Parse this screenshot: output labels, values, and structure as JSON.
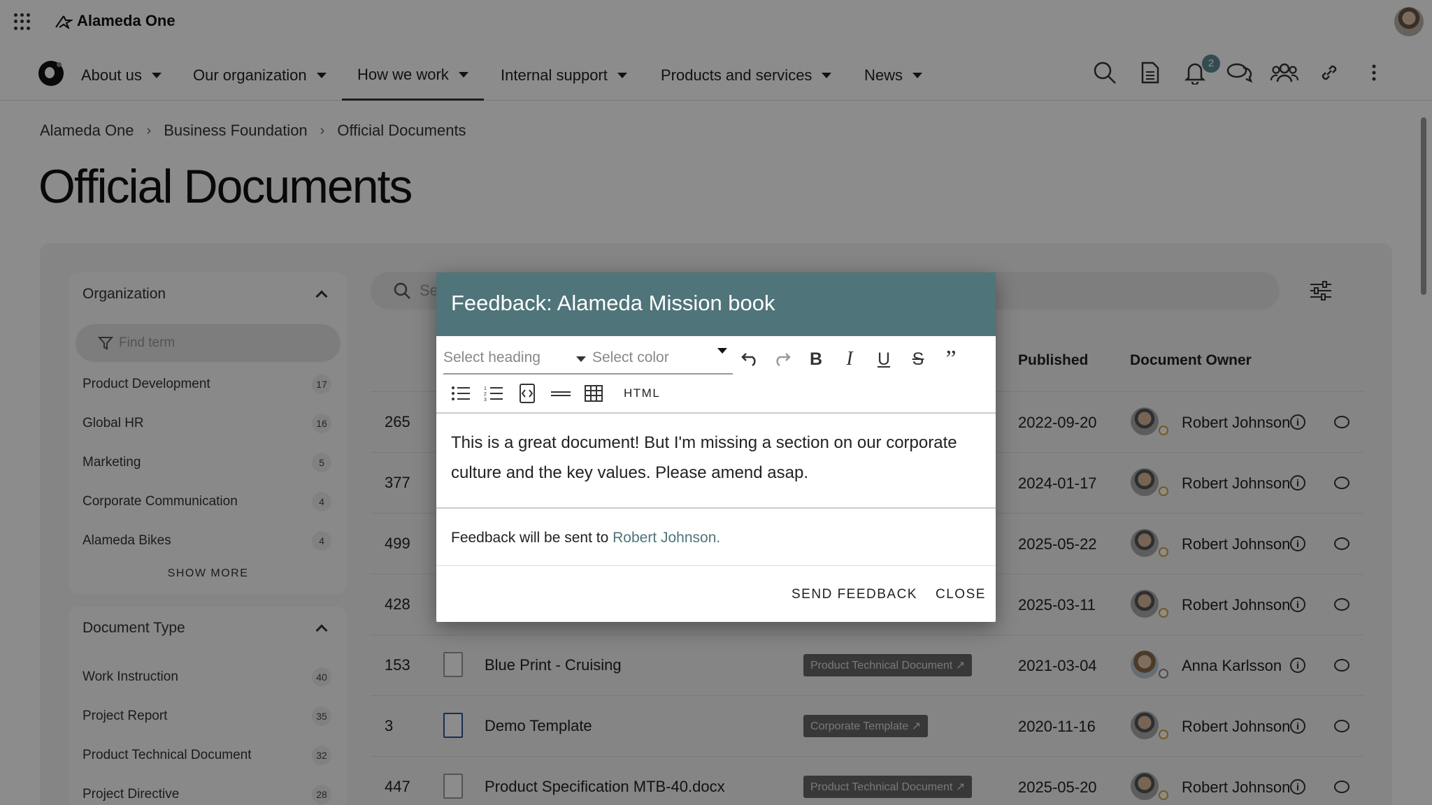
{
  "topbar": {
    "brand": "Alameda One",
    "notification_count": "2"
  },
  "nav": [
    {
      "label": "About us"
    },
    {
      "label": "Our organization"
    },
    {
      "label": "How we work"
    },
    {
      "label": "Internal support"
    },
    {
      "label": "Products and services"
    },
    {
      "label": "News"
    }
  ],
  "breadcrumb": [
    "Alameda One",
    "Business Foundation",
    "Official Documents"
  ],
  "page_title": "Official Documents",
  "filters": {
    "organization": {
      "title": "Organization",
      "find_placeholder": "Find term",
      "terms": [
        {
          "label": "Product Development",
          "count": "17"
        },
        {
          "label": "Global HR",
          "count": "16"
        },
        {
          "label": "Marketing",
          "count": "5"
        },
        {
          "label": "Corporate Communication",
          "count": "4"
        },
        {
          "label": "Alameda Bikes",
          "count": "4"
        }
      ],
      "show_more": "SHOW MORE"
    },
    "document_type": {
      "title": "Document Type",
      "terms": [
        {
          "label": "Work Instruction",
          "count": "40"
        },
        {
          "label": "Project Report",
          "count": "35"
        },
        {
          "label": "Product Technical Document",
          "count": "32"
        },
        {
          "label": "Project Directive",
          "count": "28"
        }
      ]
    }
  },
  "search": {
    "placeholder": "Se"
  },
  "table": {
    "headers": {
      "published": "Published",
      "owner": "Document Owner"
    },
    "rows": [
      {
        "id": "265",
        "title": "",
        "tag": "",
        "published": "2022-09-20",
        "owner": "Robert Johnson"
      },
      {
        "id": "377",
        "title": "",
        "tag": "",
        "published": "2024-01-17",
        "owner": "Robert Johnson"
      },
      {
        "id": "499",
        "title": "",
        "tag": "",
        "published": "2025-05-22",
        "owner": "Robert Johnson"
      },
      {
        "id": "428",
        "title": "",
        "tag": "",
        "published": "2025-03-11",
        "owner": "Robert Johnson"
      },
      {
        "id": "153",
        "title": "Blue Print - Cruising",
        "tag": "Product Technical Document",
        "published": "2021-03-04",
        "owner": "Anna Karlsson"
      },
      {
        "id": "3",
        "title": "Demo Template",
        "tag": "Corporate Template",
        "published": "2020-11-16",
        "owner": "Robert Johnson"
      },
      {
        "id": "447",
        "title": "Product Specification MTB-40.docx",
        "tag": "Product Technical Document",
        "published": "2025-05-20",
        "owner": "Robert Johnson"
      }
    ]
  },
  "modal": {
    "title": "Feedback: Alameda Mission book",
    "heading_select": "Select heading",
    "color_select": "Select color",
    "html_button": "HTML",
    "body_text": "This is a great document! But I'm missing a section on our corporate culture and the key values. Please amend asap.",
    "recipient_prefix": "Feedback will be sent to ",
    "recipient": "Robert Johnson.",
    "send": "SEND FEEDBACK",
    "close": "CLOSE"
  },
  "colors": {
    "modal_header": "#4f7479",
    "link": "#4f7479",
    "badge": "#5b8a95"
  }
}
